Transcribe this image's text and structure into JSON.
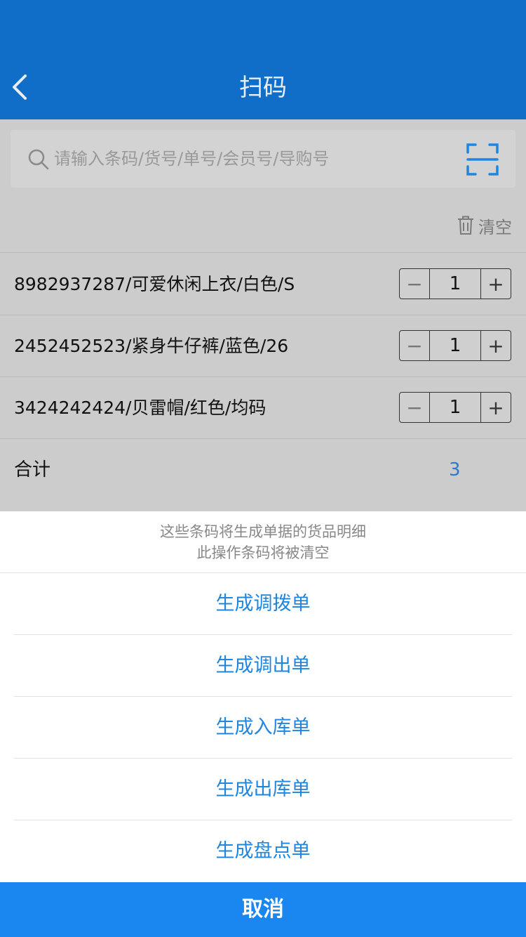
{
  "header": {
    "title": "扫码",
    "back_icon": "chevron-left-icon"
  },
  "search": {
    "placeholder": "请输入条码/货号/单号/会员号/导购号",
    "value": "",
    "scan_icon": "scan-icon"
  },
  "toolbar": {
    "clear_label": "清空"
  },
  "items": [
    {
      "label": "8982937287/可爱休闲上衣/白色/S",
      "qty": "1"
    },
    {
      "label": "2452452523/紧身牛仔裤/蓝色/26",
      "qty": "1"
    },
    {
      "label": "3424242424/贝雷帽/红色/均码",
      "qty": "1"
    }
  ],
  "stepper": {
    "minus": "−",
    "plus": "+"
  },
  "total": {
    "label": "合计",
    "value": "3"
  },
  "sheet": {
    "message_line1": "这些条码将生成单据的货品明细",
    "message_line2": "此操作条码将被清空",
    "options": [
      "生成调拨单",
      "生成调出单",
      "生成入库单",
      "生成出库单",
      "生成盘点单"
    ],
    "cancel_label": "取消"
  },
  "colors": {
    "header": "#106ec8",
    "accent": "#1e86e0",
    "cancel": "#1a87f0",
    "total": "#2f79c6"
  }
}
